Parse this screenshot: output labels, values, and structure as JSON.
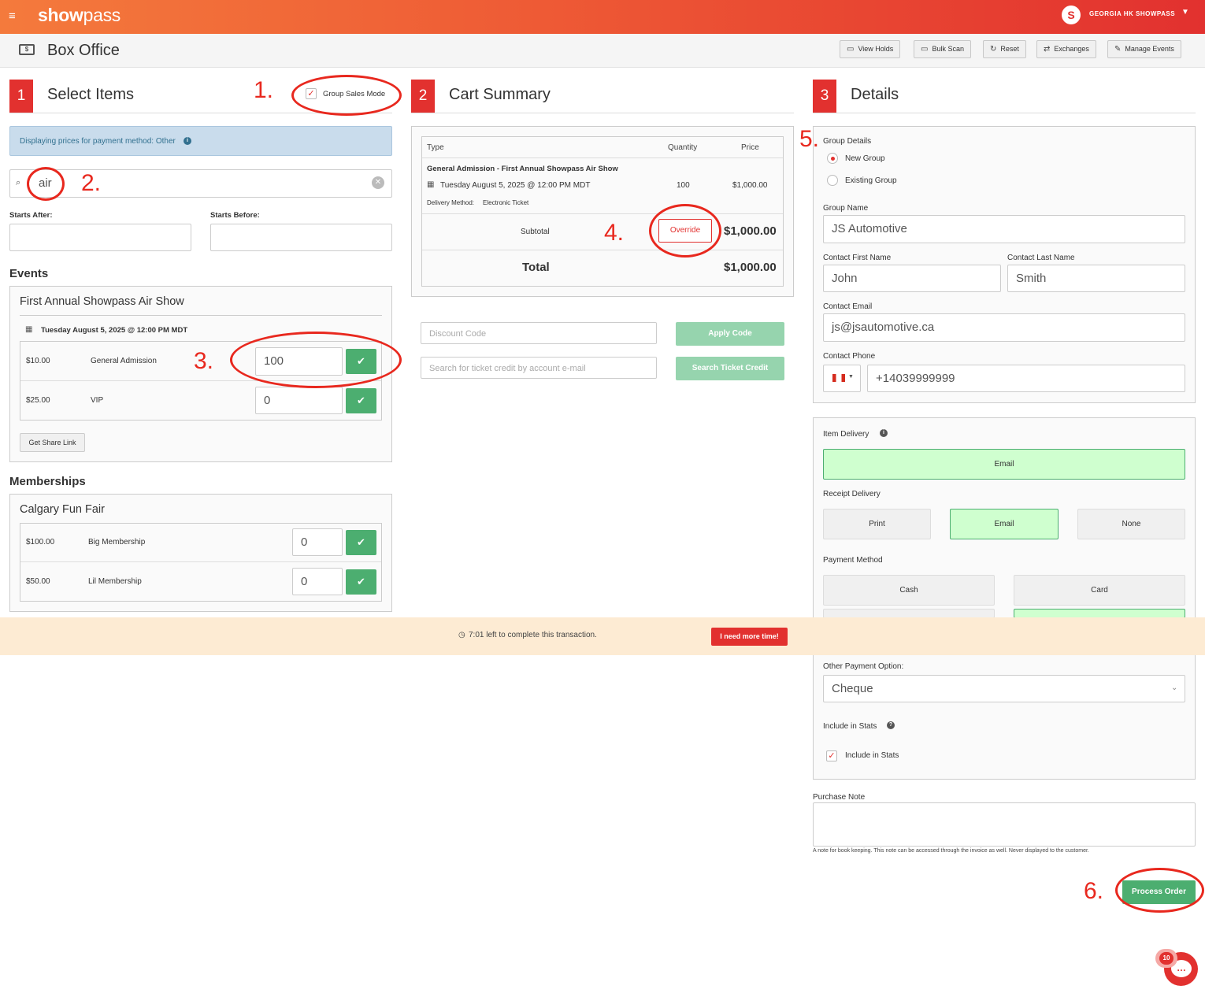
{
  "app": {
    "logo_bold": "show",
    "logo_light": "pass",
    "account_name": "GEORGIA HK SHOWPASS"
  },
  "header": {
    "title": "Box Office"
  },
  "toolbar": {
    "view_holds": "View Holds",
    "bulk_scan": "Bulk Scan",
    "reset": "Reset",
    "exchanges": "Exchanges",
    "manage_events": "Manage Events"
  },
  "select_items": {
    "number": "1",
    "title": "Select Items",
    "group_sales_mode_label": "Group Sales Mode",
    "info_text": "Displaying prices for payment method: Other",
    "search_value": "air",
    "starts_after_label": "Starts After:",
    "starts_before_label": "Starts Before:",
    "events_heading": "Events",
    "event": {
      "name": "First Annual Showpass Air Show",
      "date": "Tuesday August 5, 2025 @ 12:00 PM MDT",
      "tickets": [
        {
          "price": "$10.00",
          "name": "General Admission",
          "qty": "100"
        },
        {
          "price": "$25.00",
          "name": "VIP",
          "qty": "0"
        }
      ],
      "share_link_label": "Get Share Link"
    },
    "memberships_heading": "Memberships",
    "membership": {
      "name": "Calgary Fun Fair",
      "items": [
        {
          "price": "$100.00",
          "name": "Big Membership",
          "qty": "0"
        },
        {
          "price": "$50.00",
          "name": "Lil Membership",
          "qty": "0"
        }
      ]
    }
  },
  "cart": {
    "number": "2",
    "title": "Cart Summary",
    "col_type": "Type",
    "col_quantity": "Quantity",
    "col_price": "Price",
    "item_title": "General Admission - First Annual Showpass Air Show",
    "item_date": "Tuesday August 5, 2025 @ 12:00 PM MDT",
    "item_qty": "100",
    "item_price": "$1,000.00",
    "delivery_label": "Delivery Method:",
    "delivery_value": "Electronic Ticket",
    "subtotal_label": "Subtotal",
    "override_label": "Override",
    "subtotal_value": "$1,000.00",
    "total_label": "Total",
    "total_value": "$1,000.00",
    "discount_placeholder": "Discount Code",
    "apply_code_label": "Apply Code",
    "credit_placeholder": "Search for ticket credit by account e-mail",
    "search_credit_label": "Search Ticket Credit"
  },
  "details": {
    "number": "3",
    "title": "Details",
    "group_details_label": "Group Details",
    "new_group_label": "New Group",
    "existing_group_label": "Existing Group",
    "group_name_label": "Group Name",
    "group_name_value": "JS Automotive",
    "first_name_label": "Contact First Name",
    "first_name_value": "John",
    "last_name_label": "Contact Last Name",
    "last_name_value": "Smith",
    "email_label": "Contact Email",
    "email_value": "js@jsautomotive.ca",
    "phone_label": "Contact Phone",
    "phone_value": "+14039999999",
    "item_delivery_label": "Item Delivery",
    "item_delivery_email": "Email",
    "receipt_delivery_label": "Receipt Delivery",
    "receipt_print": "Print",
    "receipt_email": "Email",
    "receipt_none": "None",
    "payment_method_label": "Payment Method",
    "pay_cash": "Cash",
    "pay_card": "Card",
    "other_payment_label": "Other Payment Option:",
    "other_payment_value": "Cheque",
    "include_stats_label": "Include in Stats",
    "include_stats_checkbox_label": "Include in Stats",
    "purchase_note_label": "Purchase Note",
    "purchase_note_help": "A note for book keeping. This note can be accessed through the invoice as well. Never displayed to the customer.",
    "process_order_label": "Process Order"
  },
  "timer": {
    "text": "7:01 left to complete this transaction.",
    "more_time_label": "I need more time!"
  },
  "chat": {
    "badge": "10"
  },
  "annotations": [
    "1.",
    "2.",
    "3.",
    "4.",
    "5.",
    "6."
  ],
  "colors": {
    "brand_red": "#e2312f",
    "green": "#4cae70",
    "annotation_red": "#e8281e"
  }
}
